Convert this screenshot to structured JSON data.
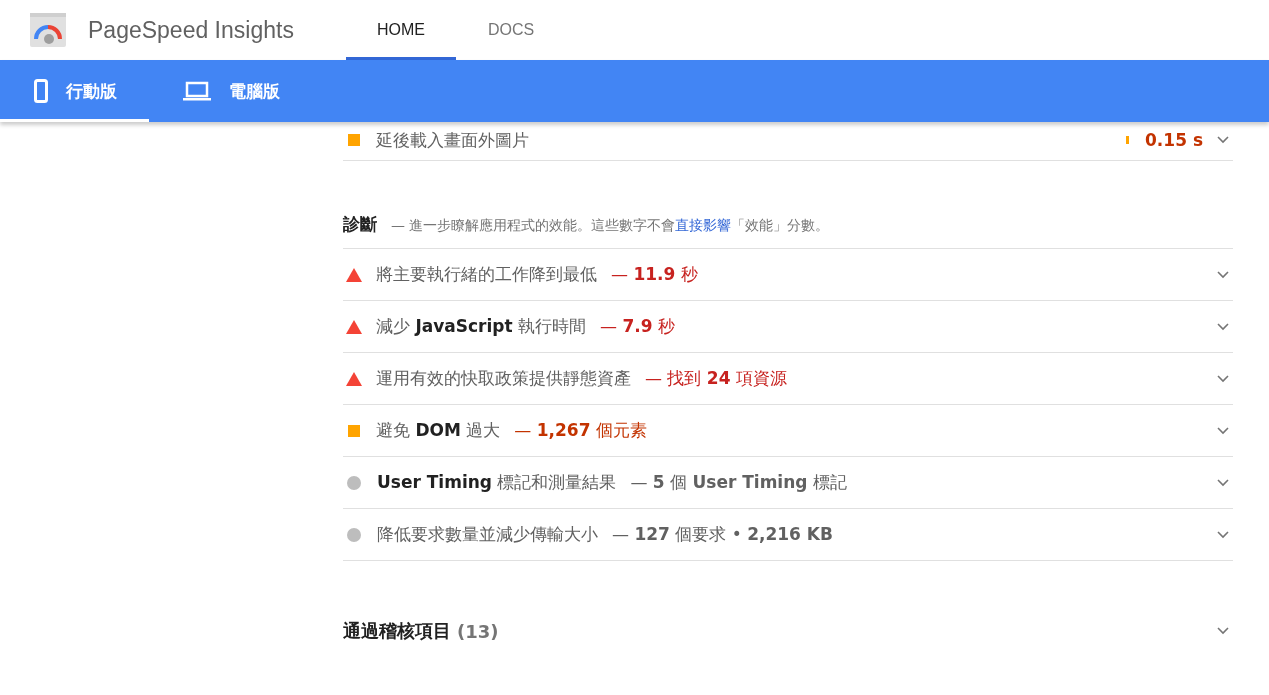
{
  "header": {
    "title": "PageSpeed Insights",
    "tabs": [
      {
        "label": "HOME",
        "selected": true
      },
      {
        "label": "DOCS",
        "selected": false
      }
    ]
  },
  "device_tabs": [
    {
      "kind": "mobile",
      "label": "行動版",
      "selected": true
    },
    {
      "kind": "desktop",
      "label": "電腦版",
      "selected": false
    }
  ],
  "opportunity": {
    "kind": "average",
    "title": "延後載入畫面外圖片",
    "savings": "0.15 s"
  },
  "diagnostics": {
    "title": "診斷",
    "description_before": "— 進一步瞭解應用程式的效能。這些數字不會",
    "link": "直接影響",
    "description_after": "「效能」分數。",
    "items": [
      {
        "kind": "fail",
        "title": "將主要執行緒的工作降到最低",
        "value": "— **11.9** 秒"
      },
      {
        "kind": "fail",
        "title": "減少 **JavaScript** 執行時間",
        "value": "— **7.9** 秒"
      },
      {
        "kind": "fail",
        "title": "運用有效的快取政策提供靜態資產",
        "value": "— 找到 **24** 項資源"
      },
      {
        "kind": "average",
        "title": "避免 **DOM** 過大",
        "value": "— **1,267** 個元素"
      },
      {
        "kind": "info",
        "title": "**User Timing** 標記和測量結果",
        "value": "— **5** 個 **User Timing** 標記"
      },
      {
        "kind": "info",
        "title": "降低要求數量並減少傳輸大小",
        "value": "— **127** 個要求 • **2,216 KB**"
      }
    ]
  },
  "passed": {
    "title": "通過稽核項目",
    "count": "(13)"
  }
}
